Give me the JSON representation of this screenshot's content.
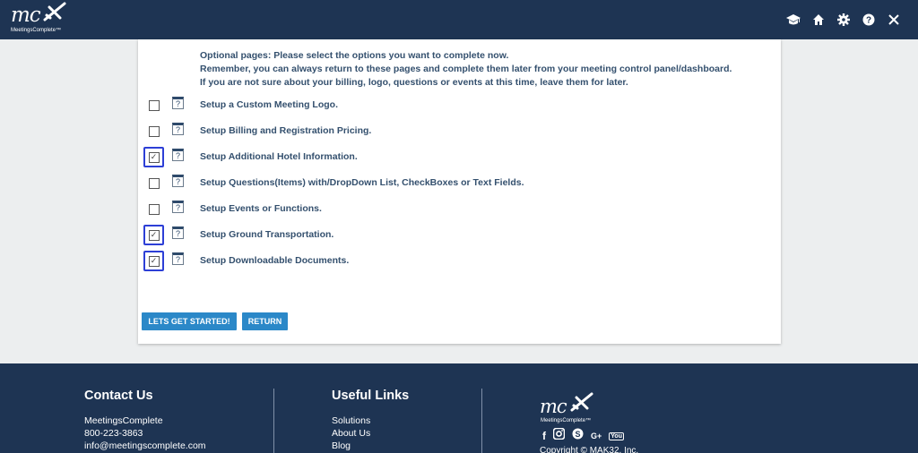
{
  "header": {
    "logo_mark": "mc",
    "logo_sub": "MeetingsComplete™",
    "icons": [
      "graduation-cap-icon",
      "home-icon",
      "gear-icon",
      "help-icon",
      "close-icon"
    ]
  },
  "intro": {
    "line1": "Optional pages: Please select the options you want to complete now.",
    "line2": "Remember, you can always return to these pages and complete them later from your meeting control panel/dashboard.",
    "line3": "If you are not sure about your billing, logo, questions or events at this time, leave them for later."
  },
  "help_glyph": "?",
  "check_glyph": "✓",
  "options": [
    {
      "label": "Setup a Custom Meeting Logo.",
      "checked": false
    },
    {
      "label": "Setup Billing and Registration Pricing.",
      "checked": false
    },
    {
      "label": "Setup Additional Hotel Information.",
      "checked": true
    },
    {
      "label": "Setup Questions(Items) with/DropDown List, CheckBoxes or Text Fields.",
      "checked": false
    },
    {
      "label": "Setup Events or Functions.",
      "checked": false
    },
    {
      "label": "Setup Ground Transportation.",
      "checked": true
    },
    {
      "label": "Setup Downloadable Documents.",
      "checked": true
    }
  ],
  "buttons": {
    "start": "LETS GET STARTED!",
    "return": "RETURN"
  },
  "footer": {
    "contact_heading": "Contact Us",
    "contact_name": "MeetingsComplete",
    "contact_phone": "800-223-3863",
    "contact_email": "info@meetingscomplete.com",
    "links_heading": "Useful Links",
    "links": [
      "Solutions",
      "About Us",
      "Blog"
    ],
    "logo_mark": "mc",
    "logo_sub": "MeetingsComplete™",
    "social": {
      "facebook": "f",
      "googleplus": "G+",
      "youtube": "You"
    },
    "copyright": "Copyright © MAK32, Inc."
  },
  "colors": {
    "navy": "#1e3453",
    "button_blue": "#2b88c8",
    "label_text": "#34506e",
    "selection_outline": "#2d3fd6"
  }
}
